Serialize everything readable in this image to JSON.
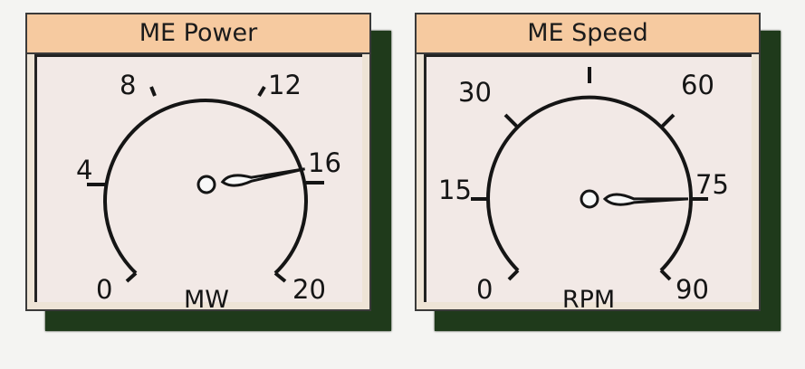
{
  "gauges": [
    {
      "title": "ME Power",
      "unit": "MW",
      "ticks": [
        "0",
        "4",
        "8",
        "12",
        "16",
        "20"
      ],
      "value_fraction": 0.8
    },
    {
      "title": "ME Speed",
      "unit": "RPM",
      "ticks": [
        "0",
        "15",
        "30",
        "60",
        "75",
        "90"
      ],
      "value_fraction": 0.833
    }
  ]
}
